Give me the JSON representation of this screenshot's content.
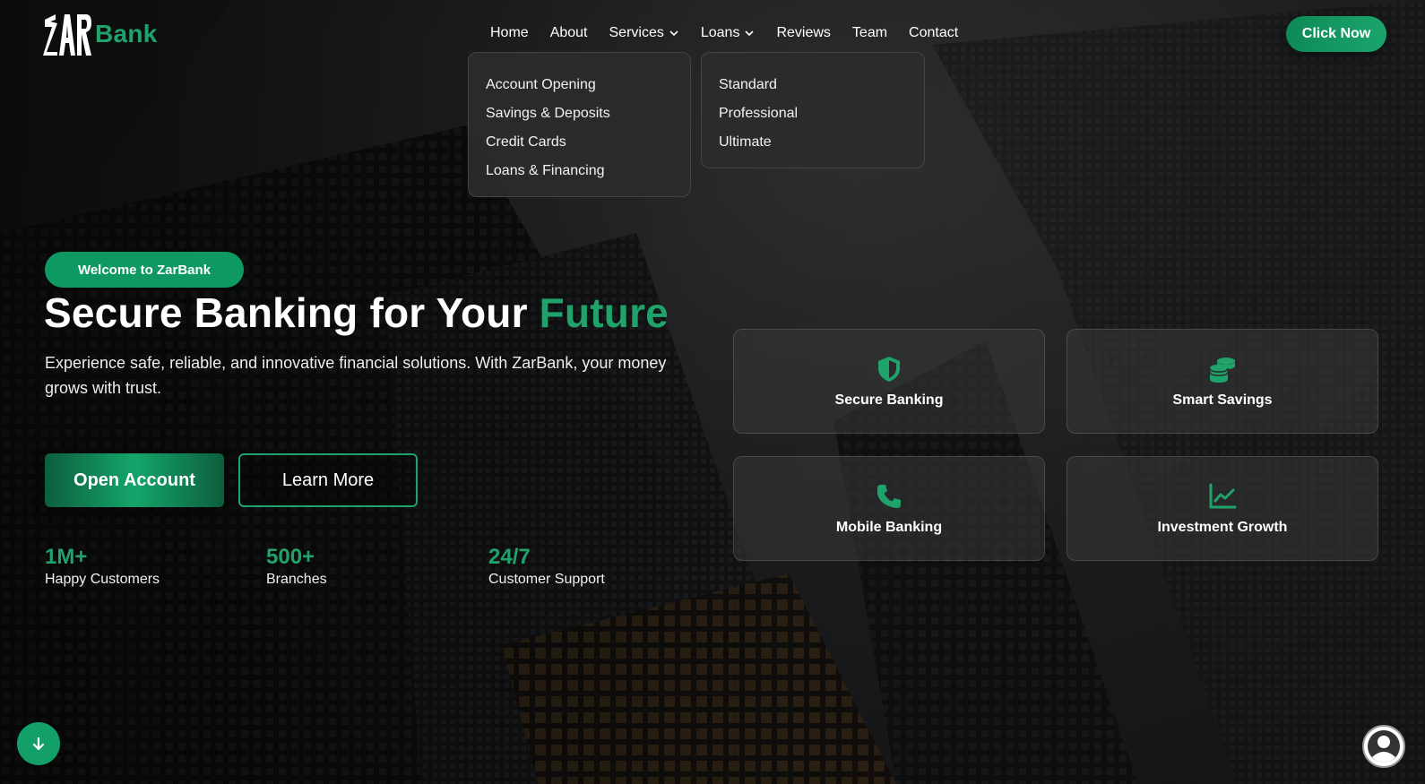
{
  "brand": {
    "name": "Bank",
    "accent_color": "#1fa36b"
  },
  "nav": {
    "items": [
      {
        "label": "Home"
      },
      {
        "label": "About"
      },
      {
        "label": "Services"
      },
      {
        "label": "Loans"
      },
      {
        "label": "Reviews"
      },
      {
        "label": "Team"
      },
      {
        "label": "Contact"
      }
    ],
    "cta_label": "Click Now"
  },
  "services_menu": [
    "Account Opening",
    "Savings & Deposits",
    "Credit Cards",
    "Loans & Financing"
  ],
  "loans_menu": [
    "Standard",
    "Professional",
    "Ultimate"
  ],
  "hero": {
    "badge": "Welcome to ZarBank",
    "title_main": "Secure Banking for Your ",
    "title_accent": "Future",
    "subtitle": "Experience safe, reliable, and innovative financial solutions. With ZarBank, your money grows with trust.",
    "primary_button": "Open Account",
    "secondary_button": "Learn More"
  },
  "stats": [
    {
      "value": "1M+",
      "label": "Happy Customers"
    },
    {
      "value": "500+",
      "label": "Branches"
    },
    {
      "value": "24/7",
      "label": "Customer Support"
    }
  ],
  "features": [
    {
      "title": "Secure Banking",
      "icon": "shield-icon"
    },
    {
      "title": "Smart Savings",
      "icon": "coins-icon"
    },
    {
      "title": "Mobile Banking",
      "icon": "phone-icon"
    },
    {
      "title": "Investment Growth",
      "icon": "chart-line-icon"
    }
  ]
}
